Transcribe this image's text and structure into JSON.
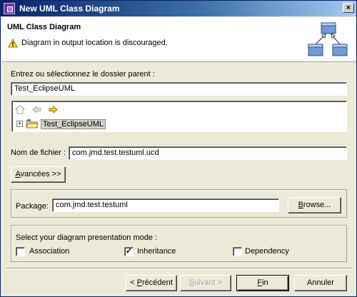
{
  "window": {
    "title": "New UML Class Diagram",
    "close_glyph": "×"
  },
  "banner": {
    "heading": "UML Class Diagram",
    "message": "Diagram in output location is discouraged."
  },
  "parent_folder": {
    "label": "Entrez ou sélectionnez le dossier parent :",
    "value": "Test_EclipseUML"
  },
  "tree": {
    "expander_glyph": "+",
    "items": [
      {
        "label": "Test_EclipseUML"
      }
    ]
  },
  "file_name": {
    "label": "Nom de fichier :",
    "value": "com.jmd.test.testuml.ucd"
  },
  "advanced_button": {
    "mnemonic": "A",
    "rest": "vancées >>"
  },
  "package": {
    "label": "Package:",
    "value": "com.jmd.test.testuml",
    "browse_mnemonic": "B",
    "browse_rest": "rowse..."
  },
  "presentation_mode": {
    "label": "Select your diagram presentation mode :",
    "options": [
      {
        "label": "Association",
        "checked": false
      },
      {
        "label": "Inheritance",
        "checked": true
      },
      {
        "label": "Dependency",
        "checked": false
      }
    ],
    "check_glyph": "✓"
  },
  "footer": {
    "back": {
      "prefix": "< ",
      "mnemonic": "P",
      "rest": "récédent"
    },
    "next": {
      "mnemonic": "S",
      "rest": "uivant >"
    },
    "finish": {
      "mnemonic": "F",
      "rest": "in"
    },
    "cancel": "Annuler"
  },
  "colors": {
    "title_start": "#0a246a",
    "title_end": "#a6caf0",
    "face": "#ece9d8"
  }
}
